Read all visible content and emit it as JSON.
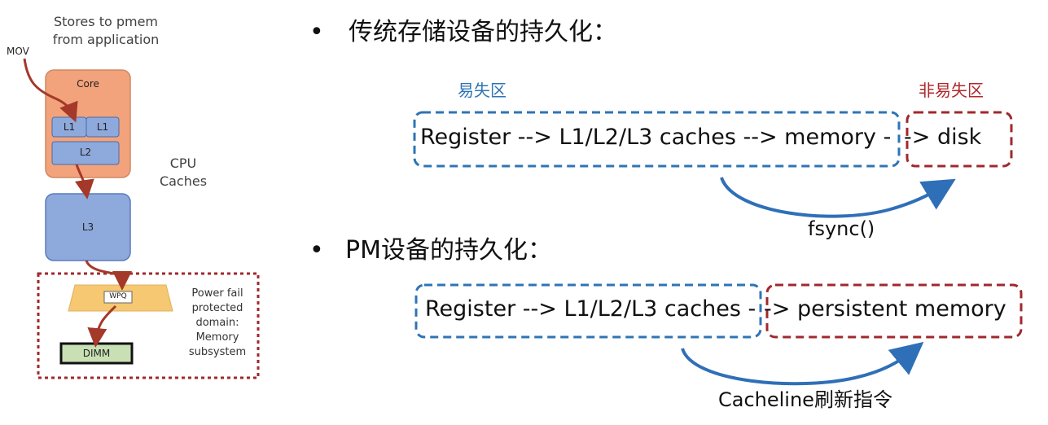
{
  "left_diagram": {
    "top_caption": [
      "Stores to pmem",
      "from application"
    ],
    "mov_label": "MOV",
    "core_label": "Core",
    "l1_a_label": "L1",
    "l1_b_label": "L1",
    "l2_label": "L2",
    "l3_label": "L3",
    "cpu_caches_label": [
      "CPU",
      "Caches"
    ],
    "wpq_label": "WPQ",
    "dimm_label": "DIMM",
    "power_fail_label": [
      "Power fail",
      "protected",
      "domain:",
      "Memory",
      "subsystem"
    ]
  },
  "section1": {
    "bullet": "•",
    "title": "传统存储设备的持久化：",
    "volatile_label": "易失区",
    "nonvolatile_label": "非易失区",
    "flow_text": "Register --> L1/L2/L3 caches --> memory -",
    "flow_tail": "-> disk",
    "arrow_label": "fsync()"
  },
  "section2": {
    "bullet": "•",
    "title": "PM设备的持久化：",
    "flow_text": "Register --> L1/L2/L3 caches -",
    "flow_tail": "-> persistent memory",
    "arrow_label": "Cacheline刷新指令"
  },
  "colors": {
    "blue_dashed": "#2e74b5",
    "red_dashed": "#a0282d",
    "volatile_label": "#2e74b5",
    "nonvolatile_label": "#b0282d",
    "core_fill": "#f2a37b",
    "cache_fill": "#8ea9db",
    "wpq_fill": "#f5c871",
    "dimm_fill": "#c8e0b4",
    "arrow_brown": "#a4392a",
    "arrow_blue": "#2f6fb7"
  }
}
